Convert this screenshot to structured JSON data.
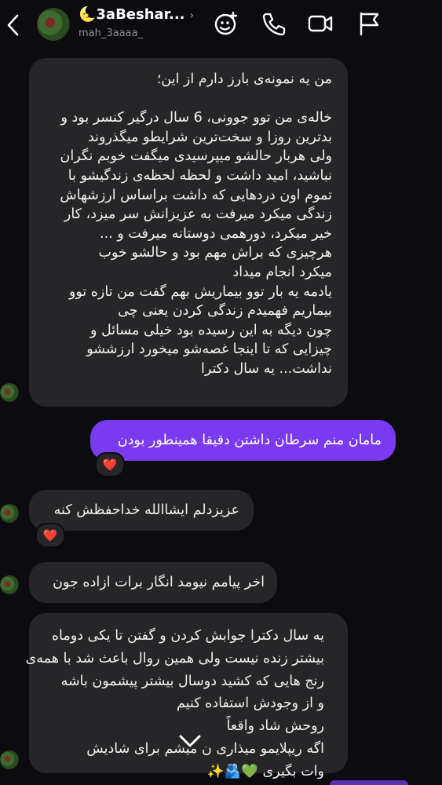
{
  "header": {
    "contact_name": "🌜3aBeshar...",
    "username": "mah_3aaaa_",
    "chevron": "›",
    "icons": [
      "back-chevron-icon",
      "effects-icon",
      "phone-icon",
      "video-icon",
      "flag-icon"
    ]
  },
  "messages": [
    {
      "direction": "in",
      "lines": [
        "من یه نمونه‌ی بارز دارم از این؛",
        "",
        "خاله‌ی من توو جوونی، 6 سال درگیر کنسر بود و",
        "بدترین روزا و سخت‌ترین شرایطو میگذروند",
        "ولی هربار حالشو میپرسیدی میگفت خوبم نگران",
        "نباشید، امید داشت و لحظه لحظه‌ی زندگیشو با",
        "تموم اون دردهایی که داشت براساس ارزشهاش",
        "زندگی میکرد میرفت به عزیزانش سر میزد، کار",
        "خیر میکرد، دورهمی دوستانه میرفت و ...",
        "هرچیزی که براش مهم بود و حالشو خوب",
        "میکرد انجام میداد",
        "یادمه یه بار توو بیماریش بهم گفت من تازه توو",
        "بیماریم فهمیدم زندگی کردن یعنی چی",
        "چون دیگه به این رسیده بود خیلی مسائل و",
        "چیزایی که تا اینجا غصه‌شو میخورد ارزششو",
        "نداشت... یه سال دکترا"
      ]
    },
    {
      "direction": "out",
      "text": "مامان منم سرطان داشتن دقیقا همینطور بودن",
      "reaction": "❤️"
    },
    {
      "direction": "in",
      "text": "عزیزدلم ایشاالله خداحفظش کنه",
      "reaction": "❤️"
    },
    {
      "direction": "in",
      "text": "اخر پیامم نیومد انگار برات ازاده جون"
    },
    {
      "direction": "in",
      "lines": [
        "یه سال دکترا جوابش کردن و گفتن تا یکی دوماه",
        "بیشتر زنده نیست ولی همین روال باعث شد با همه‌ی",
        "رنج هایی که کشید دوسال بیشتر پیشمون باشه",
        "و از وجودش استفاده کنیم",
        "روحش شاد واقعاً",
        "اگه ریپلایمو میذاری ن میشم برای شادیش",
        "وات بگیری 💚🫂✨"
      ]
    }
  ],
  "colors": {
    "background": "#0c0b10",
    "incoming_bubble": "#262629",
    "outgoing_bubble": "#7a3bf0",
    "reaction_heart": "#ff2d3a"
  }
}
